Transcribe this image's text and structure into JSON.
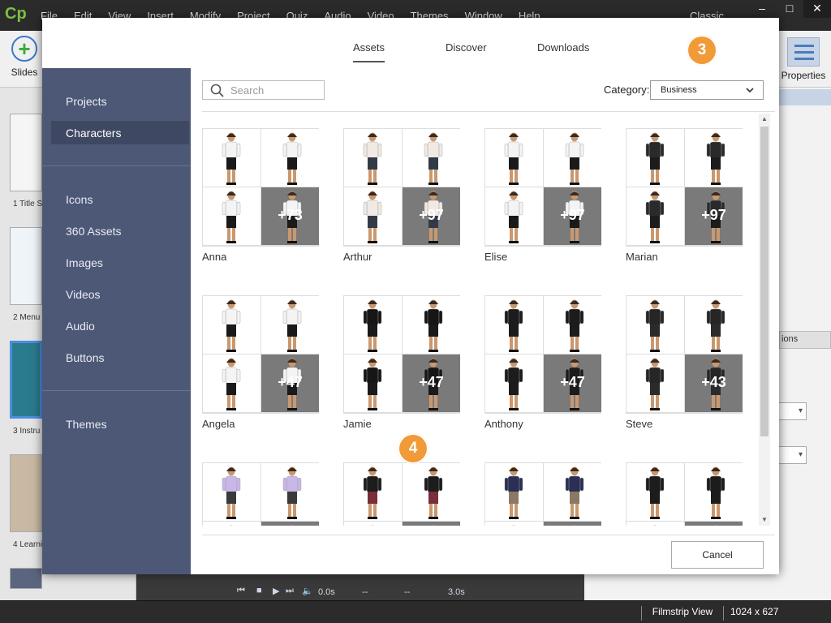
{
  "app": {
    "logo": "Cp",
    "menu": [
      "File",
      "Edit",
      "View",
      "Insert",
      "Modify",
      "Project",
      "Quiz",
      "Audio",
      "Video",
      "Themes",
      "Window",
      "Help"
    ],
    "mode": "Classic",
    "toolbar": {
      "slides_label": "Slides",
      "properties_label": "Properties"
    },
    "filmstrip": [
      {
        "label": "1 Title S"
      },
      {
        "label": "2 Menu"
      },
      {
        "label": "3 Instru"
      },
      {
        "label": "4 Learni"
      }
    ],
    "right_panel": {
      "tab_label": "ions"
    },
    "timeline": {
      "duration": "0.0s",
      "in": "--",
      "out": "--",
      "time": "3.0s"
    },
    "status": {
      "view": "Filmstrip View",
      "resolution": "1024 x 627"
    }
  },
  "dialog": {
    "tabs": [
      {
        "label": "Assets",
        "active": true
      },
      {
        "label": "Discover",
        "active": false
      },
      {
        "label": "Downloads",
        "active": false
      }
    ],
    "nav": [
      {
        "label": "Projects"
      },
      {
        "label": "Characters",
        "active": true
      },
      {
        "label": "Icons"
      },
      {
        "label": "360 Assets"
      },
      {
        "label": "Images"
      },
      {
        "label": "Videos"
      },
      {
        "label": "Audio"
      },
      {
        "label": "Buttons"
      },
      {
        "label": "Themes"
      }
    ],
    "search": {
      "placeholder": "Search"
    },
    "category": {
      "label": "Category:",
      "value": "Business"
    },
    "characters": [
      {
        "name": "Anna",
        "more": "+73",
        "colors": [
          "#1a1a1a",
          "#f4f4f4"
        ]
      },
      {
        "name": "Arthur",
        "more": "+97",
        "colors": [
          "#333a47",
          "#f1e9e4"
        ]
      },
      {
        "name": "Elise",
        "more": "+97",
        "colors": [
          "#1a1a1a",
          "#f4f4f4"
        ]
      },
      {
        "name": "Marian",
        "more": "+97",
        "colors": [
          "#1c1c1c",
          "#2a2a2a"
        ]
      },
      {
        "name": "Angela",
        "more": "+47",
        "colors": [
          "#1a1a1a",
          "#f4f4f4"
        ]
      },
      {
        "name": "Jamie",
        "more": "+47",
        "colors": [
          "#1a1a1a",
          "#161616"
        ]
      },
      {
        "name": "Anthony",
        "more": "+47",
        "colors": [
          "#1c1c1c",
          "#1c1c1c"
        ]
      },
      {
        "name": "Steve",
        "more": "+43",
        "colors": [
          "#2b2b2b",
          "#262626"
        ]
      },
      {
        "name": "",
        "more": "",
        "colors": [
          "#3a3a3a",
          "#c9b7e8"
        ]
      },
      {
        "name": "",
        "more": "",
        "colors": [
          "#7a2d3a",
          "#1c1c1c"
        ]
      },
      {
        "name": "",
        "more": "",
        "colors": [
          "#8a7a63",
          "#2a2f55"
        ]
      },
      {
        "name": "",
        "more": "",
        "colors": [
          "#1c1c1c",
          "#1c1c1c"
        ]
      }
    ],
    "cancel_label": "Cancel"
  },
  "callouts": [
    "3",
    "4"
  ]
}
